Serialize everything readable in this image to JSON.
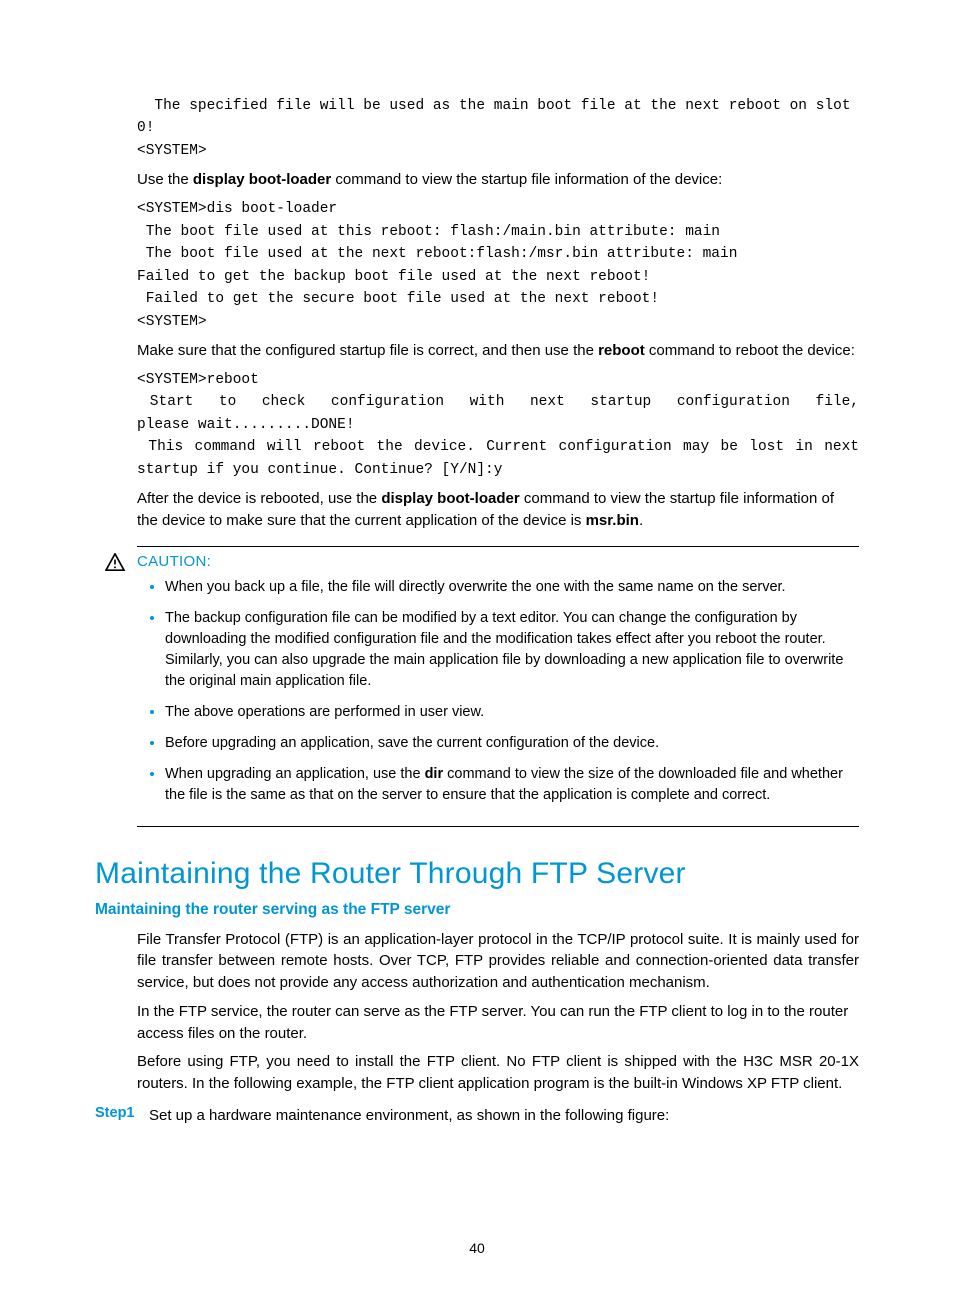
{
  "code_block_1": "  The specified file will be used as the main boot file at the next reboot on slot 0!\n<SYSTEM>",
  "para_1_a": "Use the ",
  "para_1_b": "display boot-loader",
  "para_1_c": " command to view the startup file information of the device:",
  "code_block_2": "<SYSTEM>dis boot-loader\n The boot file used at this reboot: flash:/main.bin attribute: main\n The boot file used at the next reboot:flash:/msr.bin attribute: main\nFailed to get the backup boot file used at the next reboot!\n Failed to get the secure boot file used at the next reboot!\n<SYSTEM>",
  "para_2_a": "Make sure that the configured startup file is correct, and then use the ",
  "para_2_b": "reboot",
  "para_2_c": " command to reboot the device:",
  "code_block_3": "<SYSTEM>reboot\n Start  to  check  configuration  with  next  startup  configuration  file,  please wait.........DONE!\n This command will reboot the device. Current configuration may be lost in next startup if you continue. Continue? [Y/N]:y",
  "para_3_a": "After the device is rebooted, use the ",
  "para_3_b": "display boot-loader",
  "para_3_c": " command to view the startup file information of the device to make sure that the current application of the device is ",
  "para_3_d": "msr.bin",
  "para_3_e": ".",
  "caution": {
    "label": "CAUTION:",
    "items": [
      "When you back up a file, the file will directly overwrite the one with the same name on the server.",
      "The backup configuration file can be modified by a text editor. You can change the configuration by downloading the modified configuration file and the modification takes effect after you reboot the router. Similarly, you can also upgrade the main application file by downloading a new application file to overwrite the original main application file.",
      "The above operations are performed in user view.",
      "Before upgrading an application, save the current configuration of the device.",
      {
        "pre": "When upgrading an application, use the ",
        "bold": "dir",
        "post": " command to view the size of the downloaded file and whether the file is the same as that on the server to ensure that the application is complete and correct."
      }
    ]
  },
  "h1": "Maintaining the Router Through FTP Server",
  "h2": "Maintaining the router serving as the FTP server",
  "ftp_p1": "File Transfer Protocol (FTP) is an application-layer protocol in the TCP/IP protocol suite. It is mainly used for file transfer between remote hosts. Over TCP, FTP provides reliable and connection-oriented data transfer service, but does not provide any access authorization and authentication mechanism.",
  "ftp_p2": "In the FTP service, the router can serve as the FTP server. You can run the FTP client to log in to the router access files on the router.",
  "ftp_p3": "Before using FTP, you need to install the FTP client. No FTP client is shipped with the H3C MSR 20-1X routers. In the following example, the FTP client application program is the built-in Windows XP FTP client.",
  "step1_label": "Step1",
  "step1_text": "Set up a hardware maintenance environment, as shown in the following figure:",
  "page_number": "40"
}
